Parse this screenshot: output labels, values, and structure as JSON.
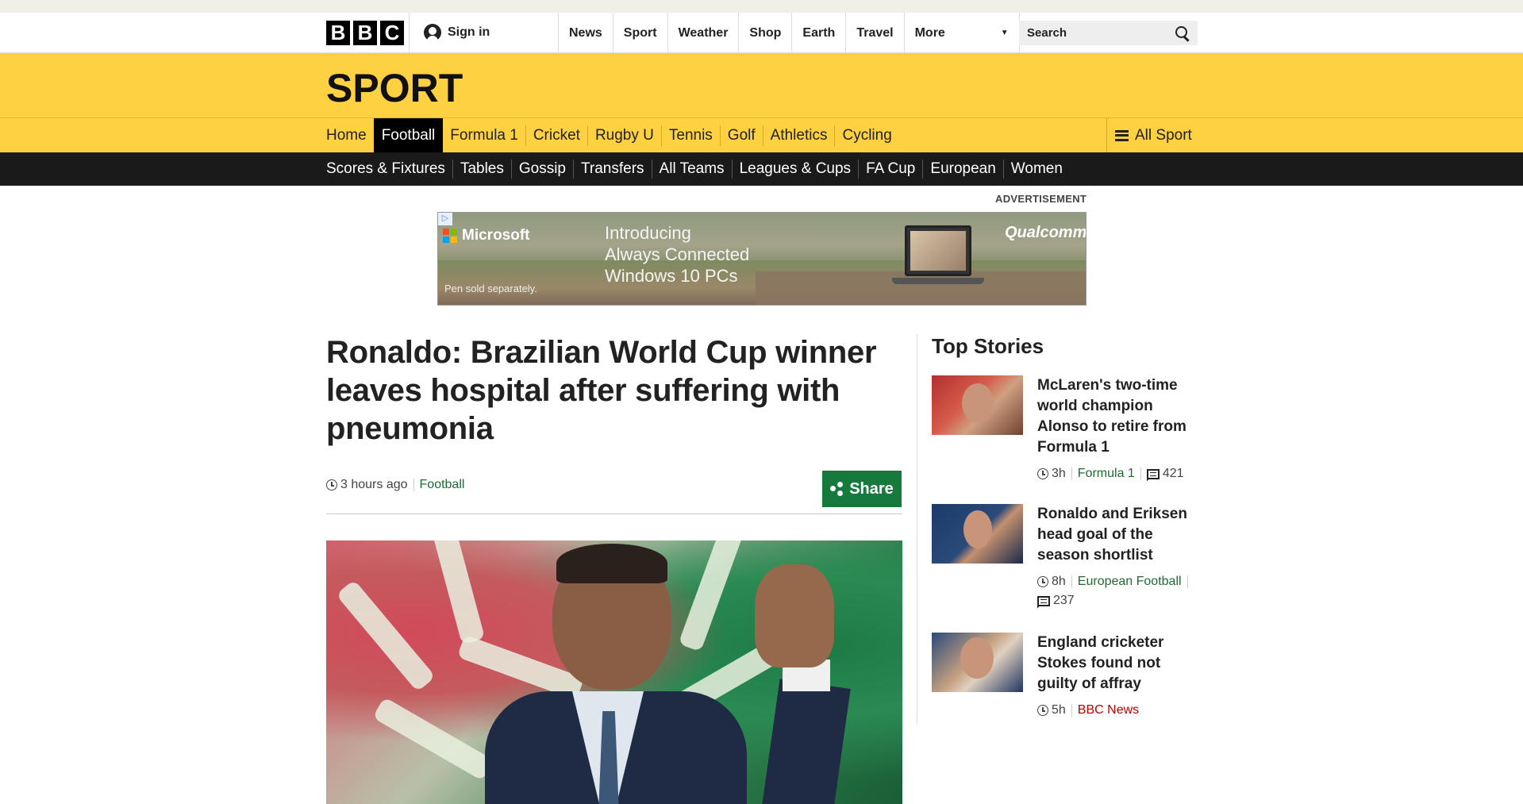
{
  "bbc": {
    "logo_letters": [
      "B",
      "B",
      "C"
    ],
    "signin_label": "Sign in",
    "topnav": [
      "News",
      "Sport",
      "Weather",
      "Shop",
      "Earth",
      "Travel"
    ],
    "more_label": "More",
    "search_placeholder": "Search"
  },
  "section": {
    "title": "SPORT",
    "nav": [
      "Home",
      "Football",
      "Formula 1",
      "Cricket",
      "Rugby U",
      "Tennis",
      "Golf",
      "Athletics",
      "Cycling"
    ],
    "active": "Football",
    "all_sport_label": "All Sport"
  },
  "subnav": [
    "Scores & Fixtures",
    "Tables",
    "Gossip",
    "Transfers",
    "All Teams",
    "Leagues & Cups",
    "FA Cup",
    "European",
    "Women"
  ],
  "advert": {
    "label": "ADVERTISEMENT",
    "brand": "Microsoft",
    "headline_lines": [
      "Introducing",
      "Always Connected",
      "Windows 10 PCs"
    ],
    "footnote": "Pen sold separately.",
    "partner": "Qualcomm"
  },
  "article": {
    "headline": "Ronaldo: Brazilian World Cup winner leaves hospital after suffering with pneumonia",
    "time": "3 hours ago",
    "category": "Football",
    "share_label": "Share"
  },
  "top_stories": {
    "title": "Top Stories",
    "items": [
      {
        "title": "McLaren's two-time world champion Alonso to retire from Formula 1",
        "time": "3h",
        "category": "Formula 1",
        "comments": "421"
      },
      {
        "title": "Ronaldo and Eriksen head goal of the season shortlist",
        "time": "8h",
        "category": "European Football",
        "comments": "237"
      },
      {
        "title": "England cricketer Stokes found not guilty of affray",
        "time": "5h",
        "category": "BBC News"
      }
    ]
  },
  "colors": {
    "sport_yellow": "#fed142",
    "subnav_black": "#1a1a1a",
    "link_green": "#1d6b32",
    "share_green": "#167a3d",
    "news_red": "#b80000"
  }
}
